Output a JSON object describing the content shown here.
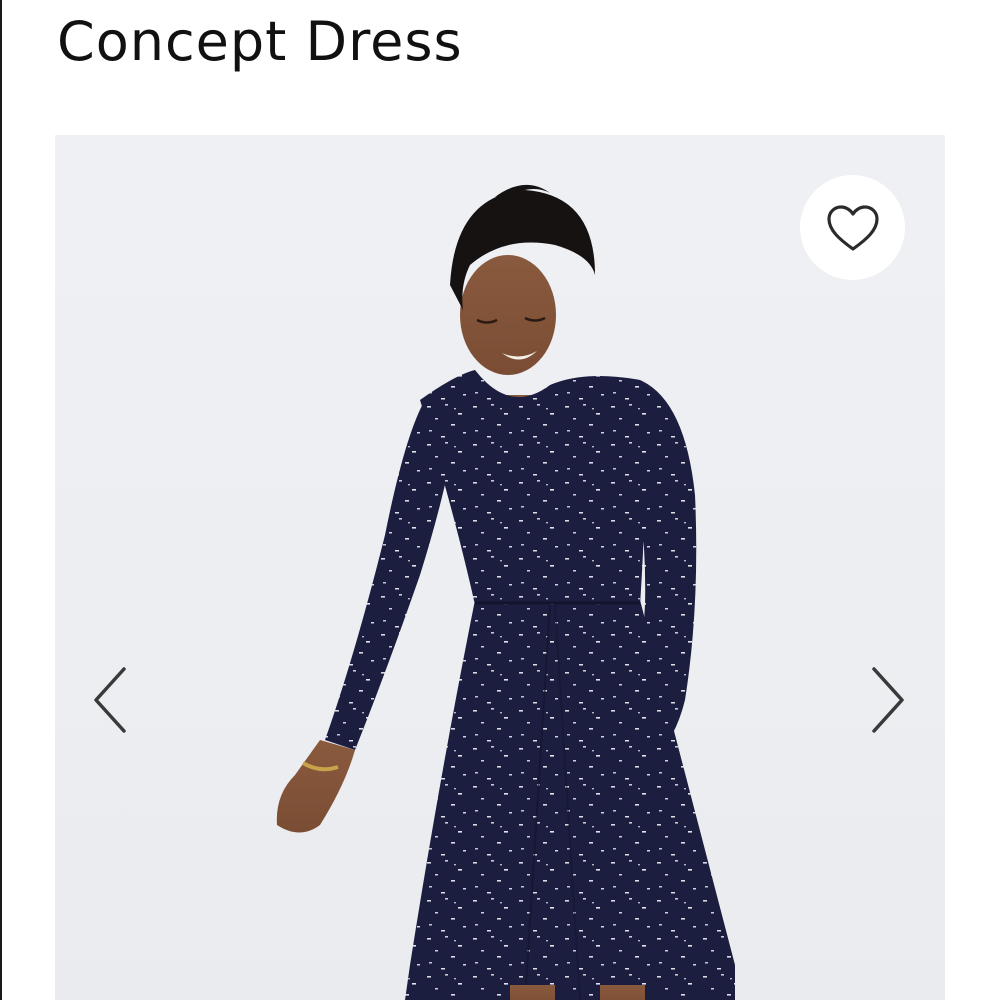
{
  "product": {
    "title": "Concept Dress"
  },
  "gallery": {
    "image_subject": "model-wearing-navy-speckled-dress",
    "favorite_icon": "heart-outline-icon",
    "prev_icon": "chevron-left-icon",
    "next_icon": "chevron-right-icon"
  },
  "colors": {
    "background": "#ffffff",
    "gallery_bg": "#eceef2",
    "dress_navy": "#1b1d3d",
    "icon_stroke": "#333333"
  }
}
